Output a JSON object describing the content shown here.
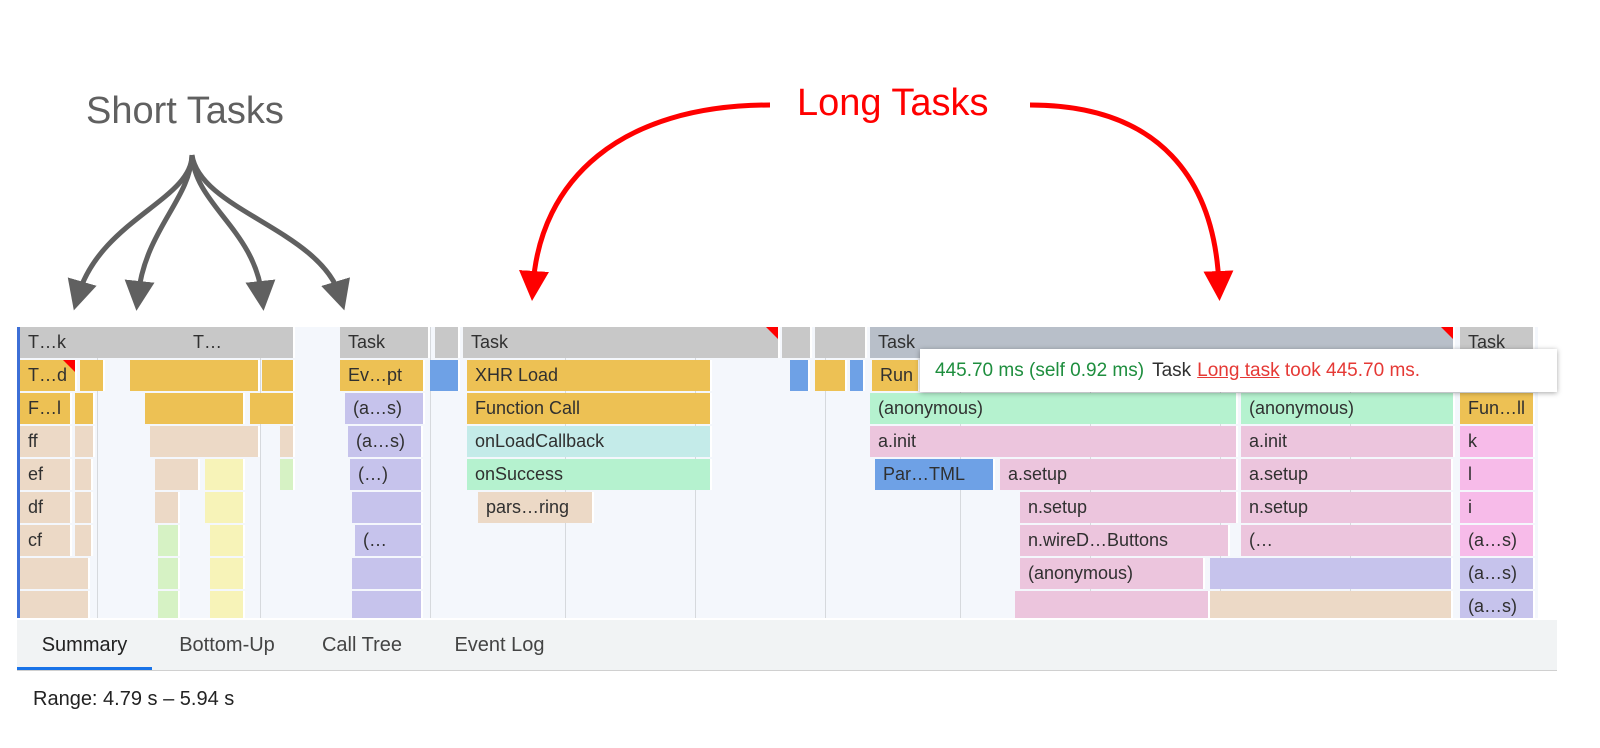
{
  "annotations": {
    "short_tasks": "Short Tasks",
    "long_tasks": "Long Tasks"
  },
  "colors": {
    "task": "#c8c8c8",
    "long_task": "#b8bfc9",
    "scripting": "#edc154",
    "long_task_marker": "#ff0000",
    "tab_accent": "#1a73e8"
  },
  "flame": {
    "row0": [
      "T…k",
      "T…",
      "Task",
      "Task",
      "Task",
      "Task"
    ],
    "row1": [
      "T…d",
      "Ev…pt",
      "XHR Load",
      "Run"
    ],
    "row2": [
      "F…l",
      "(a…s)",
      "Function Call",
      "(anonymous)",
      "(anonymous)",
      "Fun…ll"
    ],
    "row3": [
      "ff",
      "(a…s)",
      "onLoadCallback",
      "a.init",
      "a.init",
      "k"
    ],
    "row4": [
      "ef",
      "(…)",
      "onSuccess",
      "Par…TML",
      "a.setup",
      "a.setup",
      "l"
    ],
    "row5": [
      "df",
      "pars…ring",
      "n.setup",
      "n.setup",
      "i"
    ],
    "row6": [
      "cf",
      "(…",
      "n.wireD…Buttons",
      "(…",
      "(a…s)"
    ],
    "row7": [
      "(anonymous)",
      "(a…s)"
    ],
    "row8": [
      "(a…s)"
    ]
  },
  "tooltip": {
    "duration": "445.70 ms (self 0.92 ms)",
    "name": "Task",
    "warning_link": "Long task",
    "warning_text": " took 445.70 ms."
  },
  "tabs": [
    "Summary",
    "Bottom-Up",
    "Call Tree",
    "Event Log"
  ],
  "range": "Range: 4.79 s – 5.94 s"
}
